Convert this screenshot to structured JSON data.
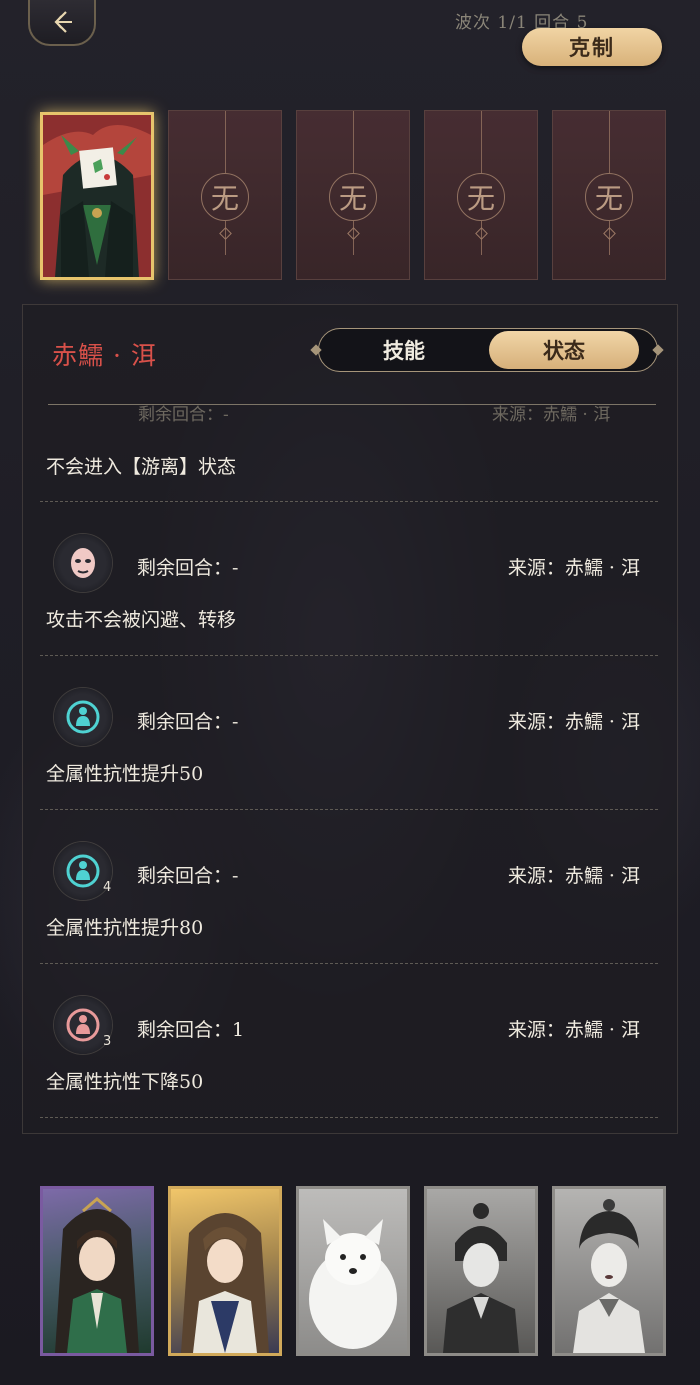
{
  "header": {
    "wave_label": "波次  1/1  回合 5",
    "counter_button": "克制"
  },
  "enemy_slots": {
    "empty_label": "无",
    "empty_count": 4
  },
  "panel": {
    "character_name": "赤鱬 · 洱",
    "tabs": {
      "skill": "技能",
      "status": "状态",
      "selected": "status"
    },
    "faded_remain": "剩余回合：-",
    "faded_source": "来源：赤鱬 · 洱",
    "effects": [
      {
        "icon": "mask-icon",
        "remain_label": "",
        "source_label": "",
        "description": "不会进入【游离】状态",
        "stack": ""
      },
      {
        "icon": "mask-icon",
        "remain_label": "剩余回合：-",
        "source_label": "来源：赤鱬 · 洱",
        "description": "攻击不会被闪避、转移",
        "stack": ""
      },
      {
        "icon": "shield-person-icon",
        "remain_label": "剩余回合：-",
        "source_label": "来源：赤鱬 · 洱",
        "description": "全属性抗性提升50",
        "stack": ""
      },
      {
        "icon": "shield-person-icon",
        "remain_label": "剩余回合：-",
        "source_label": "来源：赤鱬 · 洱",
        "description": "全属性抗性提升80",
        "stack": "4"
      },
      {
        "icon": "debuff-person-icon",
        "remain_label": "剩余回合：1",
        "source_label": "来源：赤鱬 · 洱",
        "description": "全属性抗性下降50",
        "stack": "3"
      }
    ]
  },
  "colors": {
    "accent_gold": "#e7c46c",
    "name_red": "#d9514a",
    "buff_teal": "#4fd2d2",
    "debuff_pink": "#e89a9a"
  }
}
